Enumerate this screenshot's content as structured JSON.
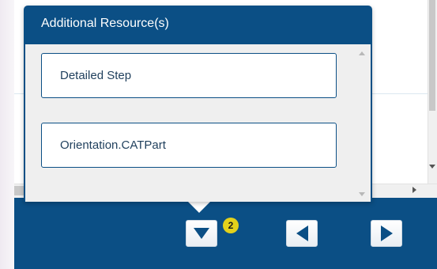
{
  "popup": {
    "title": "Additional Resource(s)",
    "items": [
      {
        "label": "Detailed Step"
      },
      {
        "label": "Orientation.CATPart"
      }
    ]
  },
  "nav": {
    "badge_count": "2",
    "icons": {
      "down": "triangle-down-icon",
      "prev": "triangle-left-icon",
      "next": "triangle-right-icon"
    }
  },
  "colors": {
    "brand_blue": "#0b4f85",
    "badge_yellow": "#e3d11b"
  }
}
